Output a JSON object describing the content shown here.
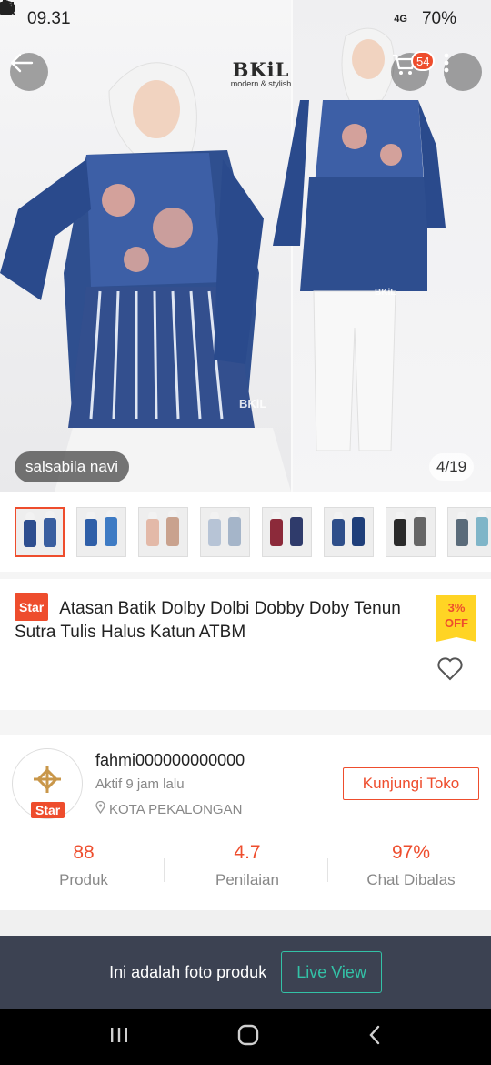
{
  "status_bar": {
    "time": "09.31",
    "network": "4G",
    "battery": "70%"
  },
  "header": {
    "brand_logo": "BKiL",
    "brand_tagline": "modern & stylish",
    "cart_count": "54",
    "icons": [
      "arrow-left-icon",
      "cart-icon",
      "more-vertical-icon"
    ]
  },
  "gallery": {
    "seller_label": "salsabila navi",
    "counter": "4/19",
    "watermark": "BKiL",
    "thumbnail_colors": [
      [
        "#2e4e8f",
        "#3a5fa0"
      ],
      [
        "#2f5fa8",
        "#3e7bc4"
      ],
      [
        "#e3b9a8",
        "#c9a28e"
      ],
      [
        "#b7c4d6",
        "#a5b5c9"
      ],
      [
        "#8c2a3a",
        "#2f3b6b"
      ],
      [
        "#2f4f8a",
        "#1f3f7a"
      ],
      [
        "#2b2b2b",
        "#666666"
      ],
      [
        "#5a6b7a",
        "#7fb5c8"
      ]
    ]
  },
  "product": {
    "badge": "Star",
    "title": "Atasan Batik Dolby Dolbi Dobby Doby Tenun Sutra Tulis Halus Katun ATBM",
    "discount_percent": "3%",
    "discount_label": "OFF"
  },
  "shop": {
    "name": "fahmi000000000000",
    "active": "Aktif 9 jam lalu",
    "location": "KOTA PEKALONGAN",
    "badge": "Star",
    "visit_button": "Kunjungi Toko",
    "stats": [
      {
        "value": "88",
        "label": "Produk"
      },
      {
        "value": "4.7",
        "label": "Penilaian"
      },
      {
        "value": "97%",
        "label": "Chat Dibalas"
      }
    ]
  },
  "live_bar": {
    "text": "Ini adalah foto produk",
    "button": "Live View"
  },
  "colors": {
    "accent": "#ee4d2d",
    "discount_bg": "#ffd424",
    "live_bar_bg": "#3c4252",
    "live_button": "#33c2a7"
  }
}
